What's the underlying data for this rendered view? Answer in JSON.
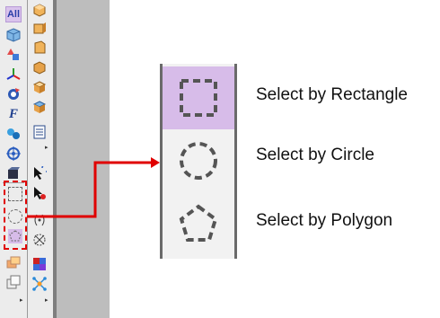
{
  "toolbar": {
    "all_button_label": "All",
    "font_button_label": "F"
  },
  "tools": [
    {
      "name": "select-by-rectangle",
      "label": "Select by Rectangle",
      "active": true
    },
    {
      "name": "select-by-circle",
      "label": "Select by Circle",
      "active": false
    },
    {
      "name": "select-by-polygon",
      "label": "Select by Polygon",
      "active": false
    }
  ],
  "colors": {
    "highlight": "#d7bce9",
    "callout": "#e00000",
    "dash": "#555555"
  }
}
